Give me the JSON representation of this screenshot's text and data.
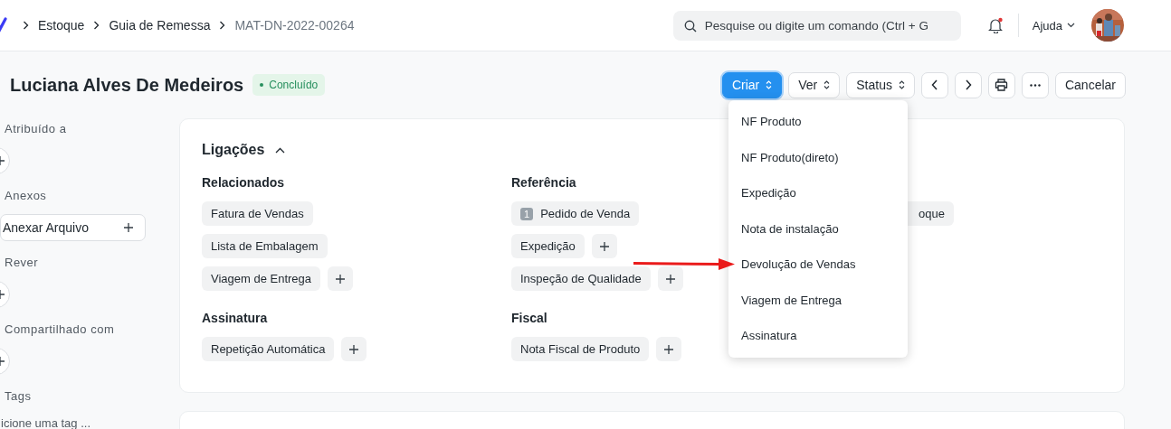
{
  "breadcrumbs": [
    "Estoque",
    "Guia de Remessa",
    "MAT-DN-2022-00264"
  ],
  "search": {
    "placeholder": "Pesquise ou digite um comando (Ctrl + G"
  },
  "notifications": {
    "unread": true
  },
  "help_menu": {
    "label": "Ajuda"
  },
  "title": "Luciana Alves De Medeiros",
  "status_badge": "Concluído",
  "toolbar": [
    {
      "kind": "dropdown",
      "label": "Criar",
      "primary": true
    },
    {
      "kind": "dropdown",
      "label": "Ver",
      "primary": false
    },
    {
      "kind": "dropdown",
      "label": "Status",
      "primary": false
    },
    {
      "kind": "prev"
    },
    {
      "kind": "next"
    },
    {
      "kind": "print"
    },
    {
      "kind": "more"
    },
    {
      "kind": "text",
      "label": "Cancelar",
      "primary": false
    }
  ],
  "sidebar": [
    {
      "kind": "assign",
      "label": "Atribuído a"
    },
    {
      "kind": "attach",
      "label": "Anexos",
      "button": "Anexar Arquivo"
    },
    {
      "kind": "assign",
      "label": "Rever"
    },
    {
      "kind": "assign",
      "label": "Compartilhado com"
    },
    {
      "kind": "tags",
      "label": "Tags",
      "placeholder": "icione uma tag ..."
    }
  ],
  "links": {
    "title": "Ligações",
    "expanded": true,
    "groups": [
      {
        "title": "Relacionados",
        "items": [
          {
            "label": "Fatura de Vendas",
            "add": false
          },
          {
            "label": "Lista de Embalagem",
            "add": false
          },
          {
            "label": "Viagem de Entrega",
            "add": true
          }
        ]
      },
      {
        "title": "Referência",
        "items": [
          {
            "label": "Pedido de Venda",
            "count": "1",
            "add": false
          },
          {
            "label": "Expedição",
            "add": true
          },
          {
            "label": "Inspeção de Qualidade",
            "add": true
          }
        ]
      },
      {
        "items": [
          {
            "label": "oque",
            "add": false
          }
        ]
      },
      {
        "title": "Assinatura",
        "items": [
          {
            "label": "Repetição Automática",
            "add": true
          }
        ]
      },
      {
        "title": "Fiscal",
        "items": [
          {
            "label": "Nota Fiscal de Produto",
            "add": true
          }
        ]
      }
    ]
  },
  "create_menu": [
    "NF Produto",
    "NF Produto(direto)",
    "Expedição",
    "Nota de instalação",
    "Devolução de Vendas",
    "Viagem de Entrega",
    "Assinatura"
  ],
  "annotation": {
    "kind": "arrow"
  }
}
